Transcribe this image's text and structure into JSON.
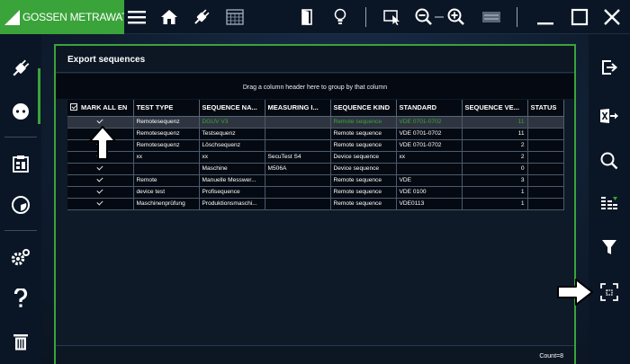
{
  "brand": {
    "name": "GOSSEN METRAWATT",
    "color": "#3aa33a"
  },
  "topbar": {
    "icons": [
      "menu-icon",
      "home-icon",
      "plug-icon",
      "calendar-icon",
      "door-icon",
      "bulb-icon",
      "select-icon",
      "zoom-out-icon",
      "zoom-in-icon",
      "keyboard-icon",
      "minimize-icon",
      "maximize-icon",
      "close-icon"
    ]
  },
  "leftnav": {
    "icons": [
      "plug-icon",
      "socket-icon",
      "clipboard-icon",
      "gauge-icon",
      "settings-icon",
      "help-icon",
      "trash-icon"
    ]
  },
  "rightnav": {
    "icons": [
      "export-icon",
      "excel-export-icon",
      "search-icon",
      "columns-icon",
      "filter-icon",
      "fit-icon"
    ]
  },
  "panel": {
    "title": "Export sequences",
    "group_hint": "Drag a column header here to group by that column",
    "columns": [
      "MARK ALL EN",
      "TEST TYPE",
      "SEQUENCE NA...",
      "MEASURING I...",
      "SEQUENCE KIND",
      "STANDARD",
      "SEQUENCE VE...",
      "STATUS"
    ],
    "rows": [
      {
        "checked": true,
        "test_type": "Remotesequenz",
        "sequence_name": "DGUV V3",
        "measuring": "",
        "kind": "Remote sequence",
        "standard": "VDE 0701-0702",
        "version": "11",
        "status": "",
        "selected": true
      },
      {
        "checked": true,
        "test_type": "Remotesequenz",
        "sequence_name": "Testsequenz",
        "measuring": "",
        "kind": "Remote sequence",
        "standard": "VDE 0701-0702",
        "version": "11",
        "status": ""
      },
      {
        "checked": true,
        "test_type": "Remotesequenz",
        "sequence_name": "Löschsequenz",
        "measuring": "",
        "kind": "Remote sequence",
        "standard": "VDE 0701-0702",
        "version": "2",
        "status": ""
      },
      {
        "checked": true,
        "test_type": "xx",
        "sequence_name": "xx",
        "measuring": "SecuTest S4",
        "kind": "Device sequence",
        "standard": "xx",
        "version": "2",
        "status": ""
      },
      {
        "checked": true,
        "test_type": "",
        "sequence_name": "Maschine",
        "measuring": "M506A",
        "kind": "Device sequence",
        "standard": "",
        "version": "0",
        "status": ""
      },
      {
        "checked": true,
        "test_type": "Remote",
        "sequence_name": "Manuelle Messwer...",
        "measuring": "",
        "kind": "Remote sequence",
        "standard": "VDE",
        "version": "3",
        "status": ""
      },
      {
        "checked": true,
        "test_type": "device test",
        "sequence_name": "Profisequence",
        "measuring": "",
        "kind": "Remote sequence",
        "standard": "VDE 0100",
        "version": "1",
        "status": ""
      },
      {
        "checked": true,
        "test_type": "Maschinenprüfung",
        "sequence_name": "Produktionsmaschi...",
        "measuring": "",
        "kind": "Remote sequence",
        "standard": "VDE0113",
        "version": "1",
        "status": ""
      }
    ],
    "count_label": "Count=8"
  }
}
